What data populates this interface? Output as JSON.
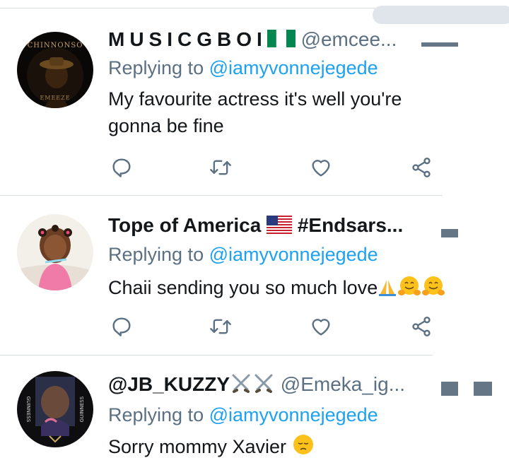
{
  "tweets": [
    {
      "display_name": "MUSICGBOI",
      "handle": "@emcee...",
      "flag": "nigeria",
      "replying_prefix": "Replying to",
      "replying_to": "@iamyvonnejegede",
      "text": "My favourite actress it's well you're gonna be fine",
      "avatar_title": "CHINNONSO",
      "avatar_caption": "EMEEZE"
    },
    {
      "display_name": "Tope of America",
      "flag": "usa",
      "hashtag": "#Endsars...",
      "replying_prefix": "Replying to",
      "replying_to": "@iamyvonnejegede",
      "text": "Chaii sending you so much love",
      "emojis": [
        "folded-hands",
        "hugging-face",
        "hugging-face"
      ]
    },
    {
      "display_name": "@JB_KUZZY",
      "handle": "@Emeka_ig...",
      "emojis_name": [
        "crossed-swords",
        "crossed-swords"
      ],
      "replying_prefix": "Replying to",
      "replying_to": "@iamyvonnejegede",
      "text": "Sorry mommy Xavier",
      "emojis": [
        "pensive-face"
      ],
      "avatar_side_text": "GUINNESS"
    }
  ],
  "actions": [
    "reply-icon",
    "retweet-icon",
    "like-icon",
    "share-icon"
  ],
  "colors": {
    "name": "#14171a",
    "muted": "#5b7083",
    "link": "#1da1f2",
    "divider": "#d8dde2"
  }
}
